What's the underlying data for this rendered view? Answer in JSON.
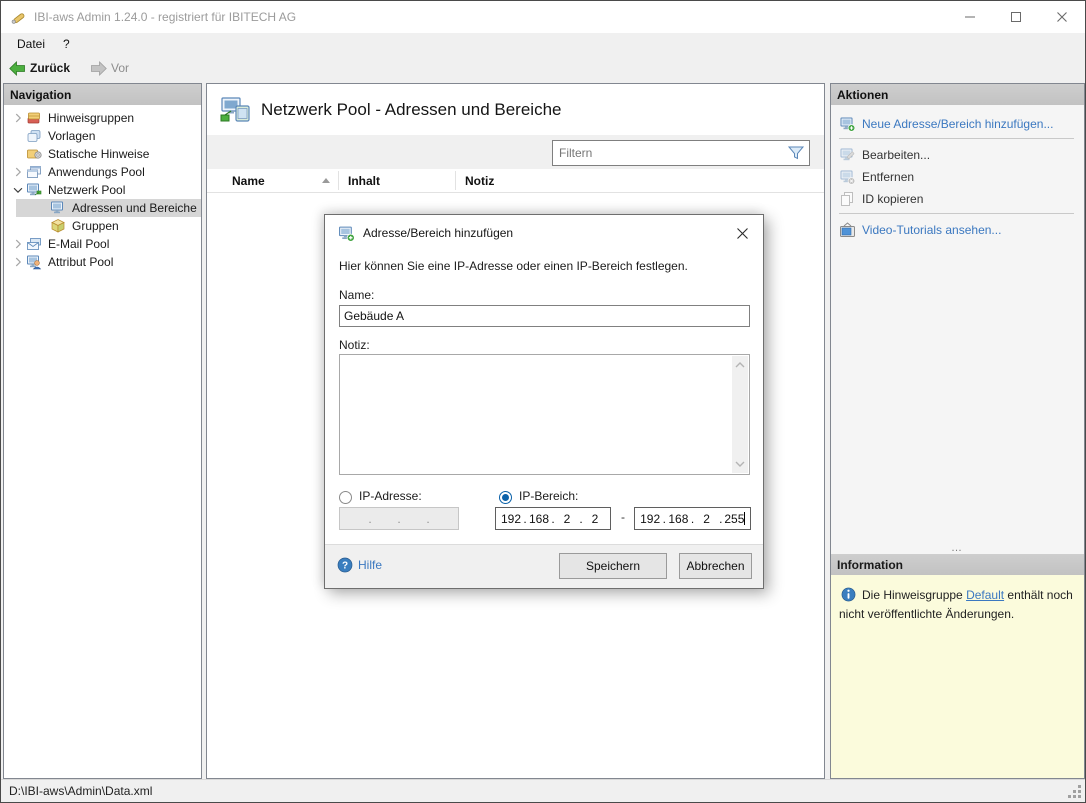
{
  "window": {
    "title": "IBI-aws Admin 1.24.0 - registriert für IBITECH AG"
  },
  "menu": {
    "items": [
      {
        "label": "Datei"
      },
      {
        "label": "?"
      }
    ]
  },
  "toolbar": {
    "back_label": "Zurück",
    "forward_label": "Vor"
  },
  "navigation": {
    "header": "Navigation",
    "items": [
      {
        "label": "Hinweisgruppen"
      },
      {
        "label": "Vorlagen"
      },
      {
        "label": "Statische Hinweise"
      },
      {
        "label": "Anwendungs Pool"
      },
      {
        "label": "Netzwerk Pool"
      },
      {
        "label": "Adressen und Bereiche"
      },
      {
        "label": "Gruppen"
      },
      {
        "label": "E-Mail Pool"
      },
      {
        "label": "Attribut Pool"
      }
    ]
  },
  "main": {
    "title": "Netzwerk Pool - Adressen und Bereiche",
    "filter_placeholder": "Filtern",
    "columns": [
      "Name",
      "Inhalt",
      "Notiz"
    ]
  },
  "actions": {
    "header": "Aktionen",
    "items": [
      {
        "label": "Neue Adresse/Bereich hinzufügen..."
      },
      {
        "label": "Bearbeiten..."
      },
      {
        "label": "Entfernen"
      },
      {
        "label": "ID kopieren"
      },
      {
        "label": "Video-Tutorials ansehen..."
      }
    ]
  },
  "information": {
    "header": "Information",
    "text_before": "Die Hinweisgruppe ",
    "link_label": "Default",
    "text_after": " enthält noch nicht veröffentlichte Änderungen."
  },
  "statusbar": {
    "path": "D:\\IBI-aws\\Admin\\Data.xml"
  },
  "dialog": {
    "title": "Adresse/Bereich hinzufügen",
    "description": "Hier können Sie eine IP-Adresse oder einen IP-Bereich festlegen.",
    "name_label": "Name:",
    "name_value": "Gebäude A",
    "note_label": "Notiz:",
    "note_value": "",
    "radio_ip_address": "IP-Adresse:",
    "radio_ip_range": "IP-Bereich:",
    "octet_separator": ".",
    "range_separator": "-",
    "ip_empty": [
      "",
      "",
      "",
      ""
    ],
    "ip_from": [
      "192",
      "168",
      "2",
      "2"
    ],
    "ip_to": [
      "192",
      "168",
      "2",
      "255"
    ],
    "help_label": "Hilfe",
    "save_label": "Speichern",
    "cancel_label": "Abbrechen"
  },
  "colors": {
    "link_blue": "#3b78c0",
    "info_background": "#fbfbdc",
    "header_gray": "#c6c6c6",
    "selection_gray": "#d6d6d6",
    "accent_green": "#3fa33f"
  }
}
